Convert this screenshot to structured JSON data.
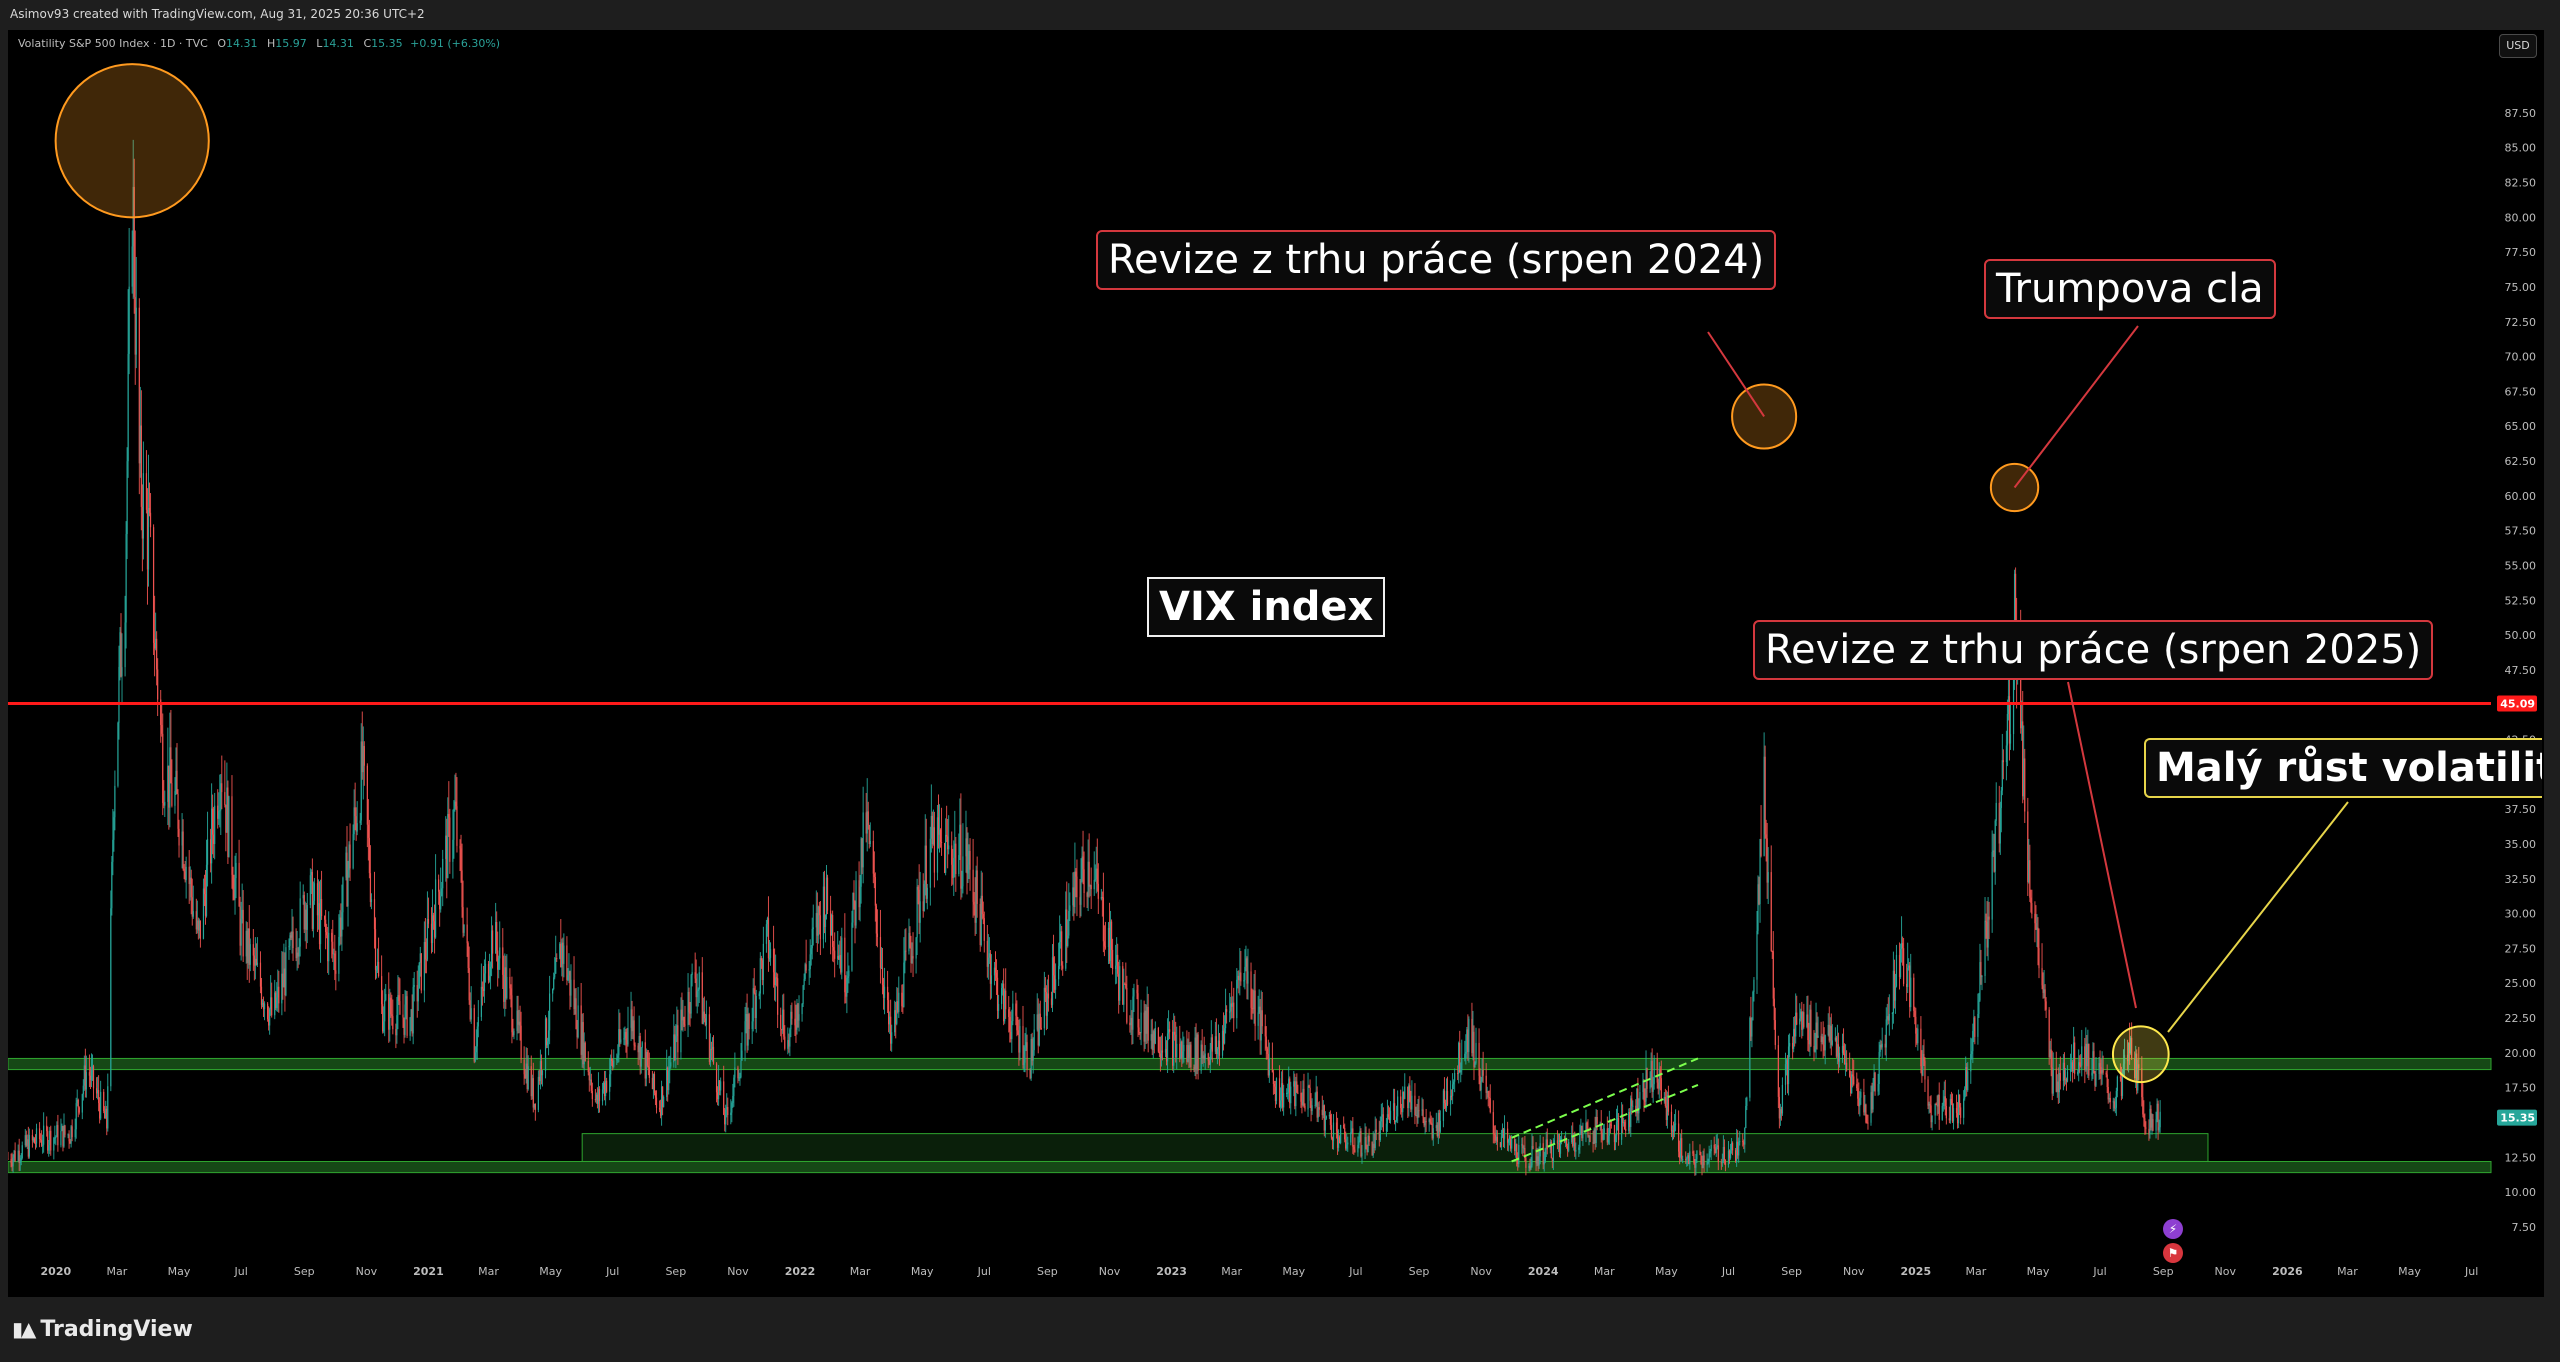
{
  "header": {
    "credit": "Asimov93 created with TradingView.com, Aug 31, 2025 20:36 UTC+2"
  },
  "legend": {
    "symbol": "Volatility S&P 500 Index · 1D · TVC",
    "o_label": "O",
    "o": "14.31",
    "h_label": "H",
    "h": "15.97",
    "l_label": "L",
    "l": "14.31",
    "c_label": "C",
    "c": "15.35",
    "change": "+0.91 (+6.30%)"
  },
  "currency_button": "USD",
  "footer": {
    "brand": "TradingView"
  },
  "annotations": {
    "labor_2024": "Revize z trhu práce (srpen 2024)",
    "tariffs": "Trumpova cla",
    "vix": "VIX index",
    "labor_2025": "Revize z trhu práce (srpen 2025)",
    "small_rise": "Malý růst volatilit"
  },
  "colors": {
    "up": "#26a69a",
    "down": "#ef5350",
    "level_line": "#ff1a1a",
    "zone": "#1c5a1c",
    "last_price": "#26a69a"
  },
  "chart_data": {
    "type": "candlestick",
    "symbol": "Volatility S&P 500 Index",
    "interval": "1D",
    "ylim": [
      5.7,
      91.3
    ],
    "y_ticks": [
      "87.50",
      "85.00",
      "82.50",
      "80.00",
      "77.50",
      "75.00",
      "72.50",
      "70.00",
      "67.50",
      "65.00",
      "62.50",
      "60.00",
      "57.50",
      "55.00",
      "52.50",
      "50.00",
      "47.50",
      "42.50",
      "40.00",
      "37.50",
      "35.00",
      "32.50",
      "30.00",
      "27.50",
      "25.00",
      "22.50",
      "20.00",
      "17.50",
      "12.50",
      "10.00",
      "7.50"
    ],
    "x_ticks": [
      "2020",
      "Mar",
      "May",
      "Jul",
      "Sep",
      "Nov",
      "2021",
      "Mar",
      "May",
      "Jul",
      "Sep",
      "Nov",
      "2022",
      "Mar",
      "May",
      "Jul",
      "Sep",
      "Nov",
      "2023",
      "Mar",
      "May",
      "Jul",
      "Sep",
      "Nov",
      "2024",
      "Mar",
      "May",
      "Jul",
      "Sep",
      "Nov",
      "2025",
      "Mar",
      "May",
      "Jul",
      "Sep",
      "Nov",
      "2026",
      "Mar",
      "May",
      "Jul"
    ],
    "x_tick_dates": [
      "2020-01-01",
      "2020-03-01",
      "2020-05-01",
      "2020-07-01",
      "2020-09-01",
      "2020-11-01",
      "2021-01-01",
      "2021-03-01",
      "2021-05-01",
      "2021-07-01",
      "2021-09-01",
      "2021-11-01",
      "2022-01-01",
      "2022-03-01",
      "2022-05-01",
      "2022-07-01",
      "2022-09-01",
      "2022-11-01",
      "2023-01-01",
      "2023-03-01",
      "2023-05-01",
      "2023-07-01",
      "2023-09-01",
      "2023-11-01",
      "2024-01-01",
      "2024-03-01",
      "2024-05-01",
      "2024-07-01",
      "2024-09-01",
      "2024-11-01",
      "2025-01-01",
      "2025-03-01",
      "2025-05-01",
      "2025-07-01",
      "2025-09-01",
      "2025-11-01",
      "2026-01-01",
      "2026-03-01",
      "2026-05-01",
      "2026-07-01"
    ],
    "x_start": "2019-11-15",
    "x_end": "2026-07-20",
    "horizontal_line": {
      "value": 45.09,
      "label": "45.09"
    },
    "last_price": {
      "value": 15.35,
      "label": "15.35"
    },
    "zones": [
      {
        "start": "2019-11-15",
        "end": "2026-07-20",
        "low": 18.8,
        "high": 19.6
      },
      {
        "start": "2019-11-15",
        "end": "2026-07-20",
        "low": 11.4,
        "high": 12.2
      },
      {
        "start": "2021-06-01",
        "end": "2025-10-15",
        "low": 12.2,
        "high": 14.2
      }
    ],
    "circles": [
      {
        "date": "2020-03-16",
        "value": 85.5,
        "radius": 5.5,
        "color": "#ff9a1f"
      },
      {
        "date": "2024-08-05",
        "value": 65.7,
        "radius": 2.3,
        "color": "#ff9a1f"
      },
      {
        "date": "2025-04-08",
        "value": 60.6,
        "radius": 1.7,
        "color": "#ff9a1f"
      },
      {
        "date": "2025-08-10",
        "value": 19.9,
        "radius": 2.0,
        "color": "#ffe94d"
      }
    ],
    "channel": [
      {
        "x1": "2023-12-01",
        "y1": 12.2,
        "x2": "2024-06-01",
        "y2": 17.7
      },
      {
        "x1": "2023-12-01",
        "y1": 13.9,
        "x2": "2024-06-01",
        "y2": 19.6
      }
    ],
    "series": [
      {
        "date": "2019-11-15",
        "close": 12.4
      },
      {
        "date": "2019-12-15",
        "close": 13.8
      },
      {
        "date": "2020-01-15",
        "close": 14.2
      },
      {
        "date": "2020-02-01",
        "close": 18.9
      },
      {
        "date": "2020-02-20",
        "close": 14.8
      },
      {
        "date": "2020-02-27",
        "close": 39.2
      },
      {
        "date": "2020-03-09",
        "close": 54.5
      },
      {
        "date": "2020-03-16",
        "close": 82.7
      },
      {
        "date": "2020-03-23",
        "close": 61.6
      },
      {
        "date": "2020-04-01",
        "close": 57.1
      },
      {
        "date": "2020-04-15",
        "close": 40.8
      },
      {
        "date": "2020-05-01",
        "close": 37.2
      },
      {
        "date": "2020-05-20",
        "close": 27.9
      },
      {
        "date": "2020-06-11",
        "close": 40.8
      },
      {
        "date": "2020-07-01",
        "close": 28.6
      },
      {
        "date": "2020-08-01",
        "close": 22.5
      },
      {
        "date": "2020-09-05",
        "close": 31.5
      },
      {
        "date": "2020-10-01",
        "close": 26.7
      },
      {
        "date": "2020-10-28",
        "close": 40.3
      },
      {
        "date": "2020-11-15",
        "close": 23.1
      },
      {
        "date": "2020-12-15",
        "close": 22.5
      },
      {
        "date": "2021-01-27",
        "close": 37.2
      },
      {
        "date": "2021-02-15",
        "close": 20.5
      },
      {
        "date": "2021-03-05",
        "close": 28.6
      },
      {
        "date": "2021-04-15",
        "close": 16.6
      },
      {
        "date": "2021-05-12",
        "close": 27.6
      },
      {
        "date": "2021-06-15",
        "close": 16.3
      },
      {
        "date": "2021-07-19",
        "close": 22.5
      },
      {
        "date": "2021-08-15",
        "close": 16.1
      },
      {
        "date": "2021-09-20",
        "close": 25.7
      },
      {
        "date": "2021-10-20",
        "close": 15.0
      },
      {
        "date": "2021-11-30",
        "close": 28.0
      },
      {
        "date": "2021-12-20",
        "close": 20.6
      },
      {
        "date": "2022-01-25",
        "close": 31.2
      },
      {
        "date": "2022-02-15",
        "close": 25.7
      },
      {
        "date": "2022-03-07",
        "close": 36.5
      },
      {
        "date": "2022-03-31",
        "close": 20.6
      },
      {
        "date": "2022-05-09",
        "close": 34.8
      },
      {
        "date": "2022-06-13",
        "close": 34.0
      },
      {
        "date": "2022-07-15",
        "close": 24.2
      },
      {
        "date": "2022-08-15",
        "close": 19.5
      },
      {
        "date": "2022-09-30",
        "close": 31.6
      },
      {
        "date": "2022-10-12",
        "close": 33.6
      },
      {
        "date": "2022-11-15",
        "close": 23.9
      },
      {
        "date": "2022-12-15",
        "close": 21.3
      },
      {
        "date": "2023-01-15",
        "close": 19.9
      },
      {
        "date": "2023-02-15",
        "close": 20.2
      },
      {
        "date": "2023-03-13",
        "close": 26.5
      },
      {
        "date": "2023-04-15",
        "close": 17.1
      },
      {
        "date": "2023-05-15",
        "close": 16.9
      },
      {
        "date": "2023-06-15",
        "close": 13.9
      },
      {
        "date": "2023-07-15",
        "close": 13.3
      },
      {
        "date": "2023-08-20",
        "close": 17.3
      },
      {
        "date": "2023-09-15",
        "close": 14.0
      },
      {
        "date": "2023-10-20",
        "close": 21.7
      },
      {
        "date": "2023-11-15",
        "close": 14.2
      },
      {
        "date": "2023-12-15",
        "close": 12.3
      },
      {
        "date": "2024-01-15",
        "close": 13.2
      },
      {
        "date": "2024-02-15",
        "close": 14.4
      },
      {
        "date": "2024-03-15",
        "close": 14.4
      },
      {
        "date": "2024-04-19",
        "close": 18.7
      },
      {
        "date": "2024-05-20",
        "close": 12.0
      },
      {
        "date": "2024-06-15",
        "close": 12.7
      },
      {
        "date": "2024-07-15",
        "close": 13.0
      },
      {
        "date": "2024-08-05",
        "close": 38.6
      },
      {
        "date": "2024-08-20",
        "close": 15.9
      },
      {
        "date": "2024-09-06",
        "close": 22.4
      },
      {
        "date": "2024-10-15",
        "close": 20.5
      },
      {
        "date": "2024-11-15",
        "close": 15.4
      },
      {
        "date": "2024-12-18",
        "close": 27.6
      },
      {
        "date": "2025-01-15",
        "close": 16.1
      },
      {
        "date": "2025-02-15",
        "close": 16.0
      },
      {
        "date": "2025-03-10",
        "close": 27.9
      },
      {
        "date": "2025-04-04",
        "close": 45.3
      },
      {
        "date": "2025-04-08",
        "close": 52.3
      },
      {
        "date": "2025-04-21",
        "close": 33.8
      },
      {
        "date": "2025-05-15",
        "close": 18.0
      },
      {
        "date": "2025-06-15",
        "close": 20.1
      },
      {
        "date": "2025-07-15",
        "close": 16.5
      },
      {
        "date": "2025-08-01",
        "close": 20.4
      },
      {
        "date": "2025-08-15",
        "close": 15.1
      },
      {
        "date": "2025-08-29",
        "close": 15.35
      }
    ]
  }
}
